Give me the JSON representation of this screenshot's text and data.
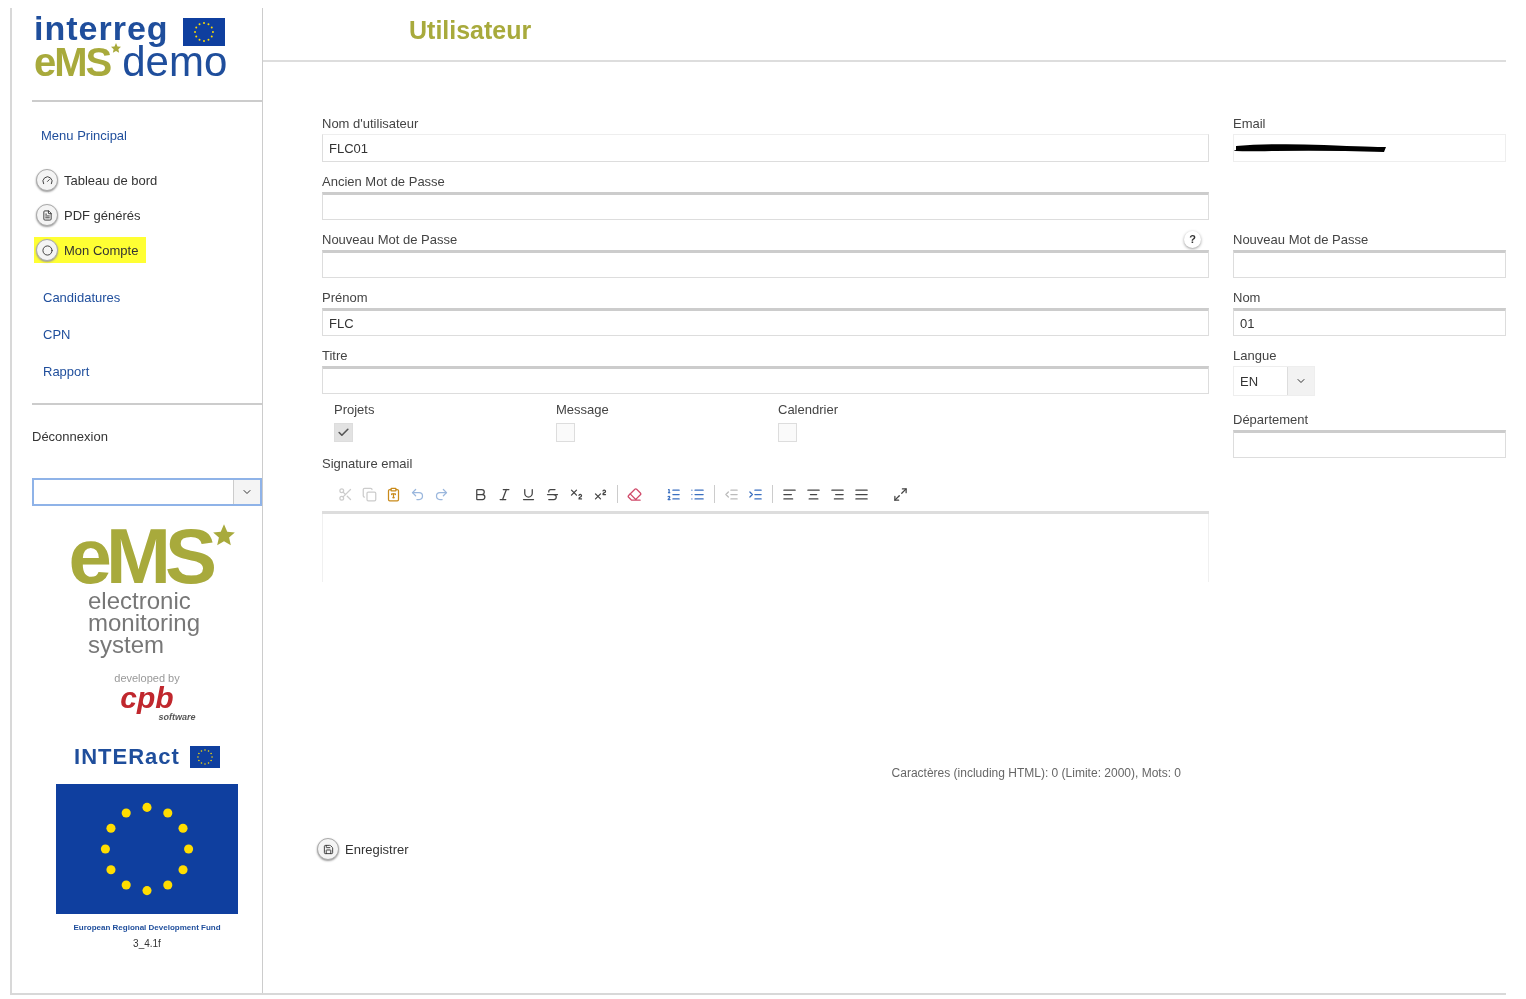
{
  "logo": {
    "top": "interreg",
    "brand": "eMS",
    "suffix": "demo"
  },
  "page_title": "Utilisateur",
  "sidebar": {
    "heading": "Menu Principal",
    "items": [
      {
        "label": "Tableau de bord",
        "kind": "icon",
        "selected": false
      },
      {
        "label": "PDF générés",
        "kind": "icon",
        "selected": false
      },
      {
        "label": "Mon Compte",
        "kind": "icon",
        "selected": true
      },
      {
        "label": "Candidatures",
        "kind": "link",
        "selected": false
      },
      {
        "label": "CPN",
        "kind": "link",
        "selected": false
      },
      {
        "label": "Rapport",
        "kind": "link",
        "selected": false
      }
    ],
    "logout": "Déconnexion",
    "footer": {
      "ems": "eMS",
      "tagline": [
        "electronic",
        "monitoring",
        "system"
      ],
      "developed_by": "developed by",
      "cpb": "cpb",
      "software": "software",
      "interact": "INTERact",
      "fund": "European Regional Development Fund",
      "version": "3_4.1f"
    }
  },
  "form": {
    "left": [
      {
        "label": "Nom d'utilisateur",
        "kind": "readonly",
        "value": "FLC01"
      },
      {
        "label": "Ancien Mot de Passe",
        "kind": "text"
      },
      {
        "label": "Nouveau Mot de Passe",
        "kind": "text",
        "help": "?"
      },
      {
        "label": "Prénom",
        "kind": "text",
        "value": "FLC"
      },
      {
        "label": "Titre",
        "kind": "text"
      }
    ],
    "right": [
      {
        "label": "Email",
        "kind": "redacted"
      },
      {
        "kind": "spacer"
      },
      {
        "label": "Nouveau Mot de Passe",
        "kind": "text"
      },
      {
        "label": "Nom",
        "kind": "text",
        "value": "01"
      },
      {
        "label": "Langue",
        "kind": "select",
        "value": "EN"
      },
      {
        "label": "Département",
        "kind": "text"
      }
    ],
    "checkboxes": [
      {
        "label": "Projets",
        "checked": true
      },
      {
        "label": "Message",
        "checked": false
      },
      {
        "label": "Calendrier",
        "checked": false
      }
    ],
    "signature_label": "Signature email",
    "counter": "Caractères (including HTML): 0 (Limite: 2000), Mots: 0",
    "save": "Enregistrer"
  }
}
